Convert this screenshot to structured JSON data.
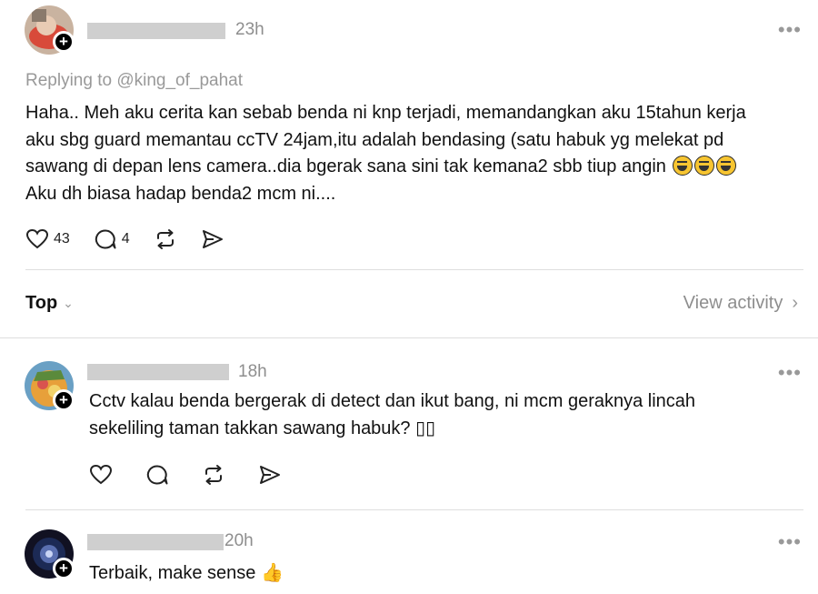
{
  "posts": [
    {
      "time": "23h",
      "replying_to": "Replying to @king_of_pahat",
      "text_lines": [
        "Haha.. Meh aku cerita kan sebab benda ni knp terjadi, memandangkan aku 15tahun kerja",
        "aku sbg guard memantau ccTV 24jam,itu adalah bendasing (satu habuk yg melekat pd",
        "sawang di depan lens camera..dia bgerak sana sini tak kemana2 sbb tiup angin",
        "Aku dh biasa hadap benda2 mcm ni...."
      ],
      "likes": "43",
      "replies": "4",
      "icons": [
        "heart-icon",
        "comment-icon",
        "repost-icon",
        "share-icon",
        "more-icon",
        "follow-plus-icon"
      ]
    },
    {
      "time": "18h",
      "text_lines": [
        "Cctv kalau benda bergerak di detect dan ikut bang, ni mcm geraknya lincah",
        "sekeliling taman takkan sawang habuk? ▯▯"
      ]
    },
    {
      "time": "20h",
      "text_lines": [
        "Terbaik, make sense 👍"
      ]
    }
  ],
  "sort": {
    "label": "Top"
  },
  "view_activity": {
    "label": "View activity"
  },
  "more_glyph": "•••",
  "plus_glyph": "+"
}
